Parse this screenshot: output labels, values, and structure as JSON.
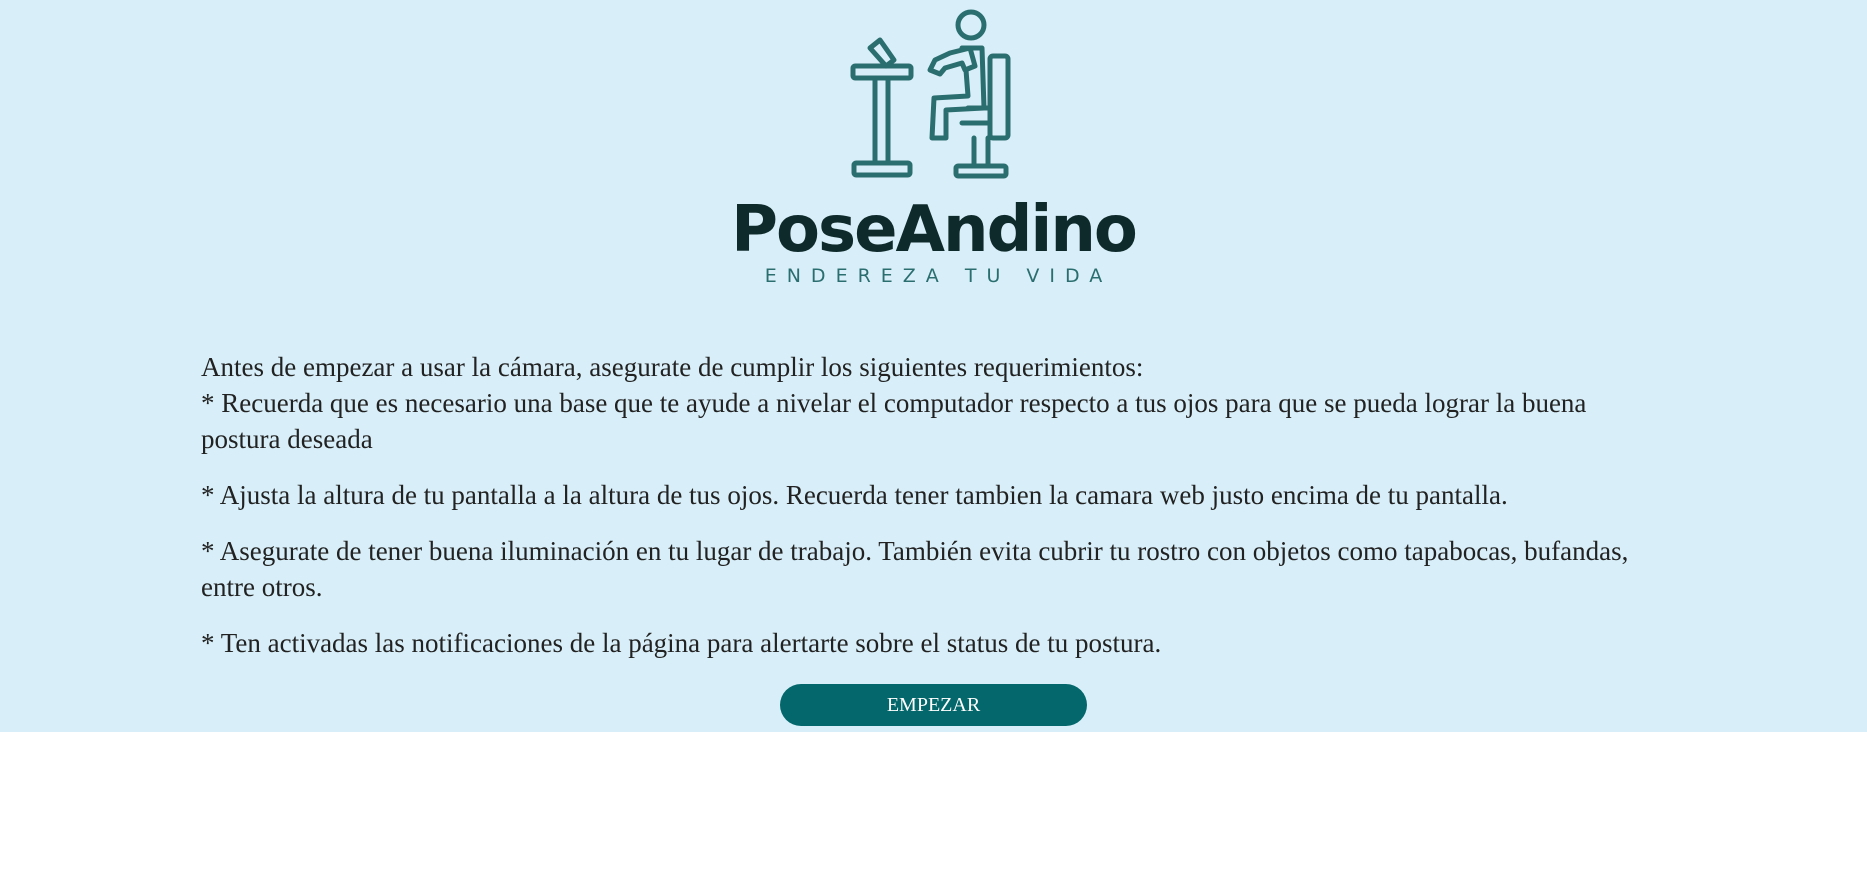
{
  "brand": {
    "name": "PoseAndino",
    "tagline": "ENDEREZA TU VIDA",
    "logo_icon": "desk-worker-icon",
    "colors": {
      "background": "#d8eff9",
      "logo_teal": "#2b6e70",
      "brand_text": "#0f2a2b",
      "button": "#03676b"
    }
  },
  "instructions": {
    "intro": "Antes de empezar a usar la cámara, asegurate de cumplir los siguientes requerimientos:",
    "items": [
      "* Recuerda que es necesario una base que te ayude a nivelar el computador respecto a tus ojos para que se pueda lograr la buena postura deseada",
      "* Ajusta la altura de tu pantalla a la altura de tus ojos. Recuerda tener tambien la camara web justo encima de tu pantalla.",
      "* Asegurate de tener buena iluminación en tu lugar de trabajo. También evita cubrir tu rostro con objetos como tapabocas, bufandas, entre otros.",
      "* Ten activadas las notificaciones de la página para alertarte sobre el status de tu postura."
    ]
  },
  "actions": {
    "start_label": "EMPEZAR"
  }
}
